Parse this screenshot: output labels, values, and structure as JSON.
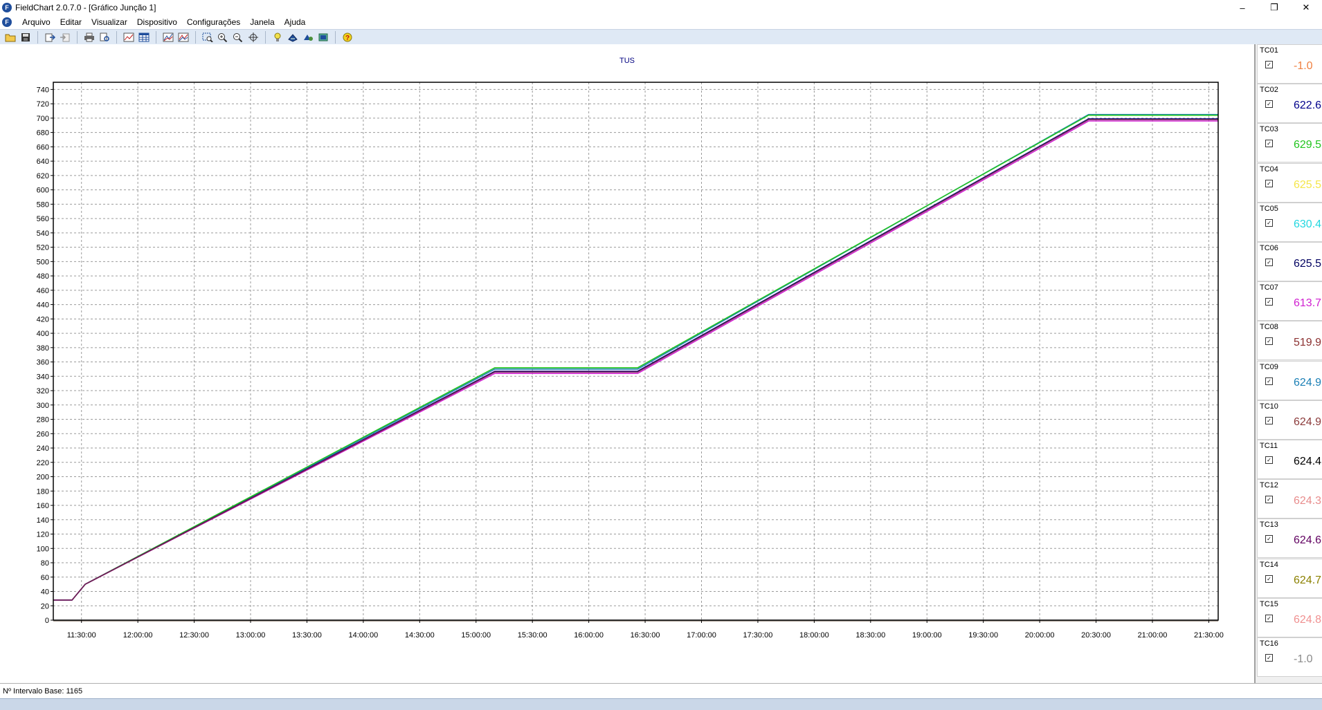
{
  "window": {
    "title": "FieldChart 2.0.7.0 - [Gráfico Junção 1]",
    "logo_letter": "F",
    "min_label": "–",
    "max_label": "❐",
    "close_label": "✕"
  },
  "menu": {
    "items": [
      "Arquivo",
      "Editar",
      "Visualizar",
      "Dispositivo",
      "Configurações",
      "Janela",
      "Ajuda"
    ],
    "mdi_min": "_",
    "mdi_restore": "❐",
    "mdi_close": "×"
  },
  "toolbar": {
    "icons": [
      "open-folder-icon",
      "save-icon",
      "export-icon",
      "import-icon",
      "print-icon",
      "print-preview-icon",
      "chart-view-icon",
      "table-view-icon",
      "chart-add-icon",
      "chart-edit-icon",
      "zoom-rect-icon",
      "zoom-in-icon",
      "zoom-out-icon",
      "crosshair-icon",
      "lightbulb-icon",
      "device-connect-icon",
      "device-config-icon",
      "device-read-icon",
      "help-icon"
    ]
  },
  "chart_data": {
    "type": "line",
    "title": "TUS",
    "xlabel": "",
    "ylabel": "",
    "ylim": [
      0,
      750
    ],
    "yticks": [
      0,
      20,
      40,
      60,
      80,
      100,
      120,
      140,
      160,
      180,
      200,
      220,
      240,
      260,
      280,
      300,
      320,
      340,
      360,
      380,
      400,
      420,
      440,
      460,
      480,
      500,
      520,
      540,
      560,
      580,
      600,
      620,
      640,
      660,
      680,
      700,
      720,
      740
    ],
    "xlim": [
      "11:15:00",
      "21:35:00"
    ],
    "xticks": [
      "11:30:00",
      "12:00:00",
      "12:30:00",
      "13:00:00",
      "13:30:00",
      "14:00:00",
      "14:30:00",
      "15:00:00",
      "15:30:00",
      "16:00:00",
      "16:30:00",
      "17:00:00",
      "17:30:00",
      "18:00:00",
      "18:30:00",
      "19:00:00",
      "19:30:00",
      "20:00:00",
      "20:30:00",
      "21:00:00",
      "21:30:00"
    ],
    "grid": true,
    "series": [
      {
        "color": "#1a7fb5",
        "x": [
          "11:15:00",
          "11:25:00",
          "11:32:00",
          "15:10:00",
          "16:26:00",
          "20:26:00",
          "21:35:00"
        ],
        "y": [
          28,
          28,
          50,
          350,
          350,
          705,
          705
        ]
      },
      {
        "color": "#22c51e",
        "x": [
          "11:15:00",
          "11:25:00",
          "11:32:00",
          "15:10:00",
          "16:26:00",
          "20:26:00",
          "21:35:00"
        ],
        "y": [
          28,
          28,
          50,
          352,
          352,
          704,
          704
        ]
      },
      {
        "color": "#000080",
        "x": [
          "11:15:00",
          "11:25:00",
          "11:32:00",
          "15:10:00",
          "16:26:00",
          "20:26:00",
          "21:35:00"
        ],
        "y": [
          28,
          28,
          50,
          347,
          347,
          699,
          699
        ]
      },
      {
        "color": "#d01fd0",
        "x": [
          "11:15:00",
          "11:25:00",
          "11:32:00",
          "15:10:00",
          "16:26:00",
          "20:26:00",
          "21:35:00"
        ],
        "y": [
          28,
          28,
          50,
          344,
          344,
          696,
          696
        ]
      },
      {
        "color": "#702050",
        "x": [
          "11:15:00",
          "11:25:00",
          "11:32:00",
          "15:10:00",
          "16:26:00",
          "20:26:00",
          "21:35:00"
        ],
        "y": [
          28,
          28,
          50,
          346,
          346,
          698,
          698
        ]
      },
      {
        "color": "#e07820",
        "x": [
          "11:15:00",
          "21:35:00"
        ],
        "y": [
          -1,
          -1
        ]
      },
      {
        "color": "#8a8a8a",
        "x": [
          "11:15:00",
          "21:35:00"
        ],
        "y": [
          -1,
          -1
        ]
      }
    ]
  },
  "channels": [
    {
      "label": "TC01",
      "zero": "0",
      "value": "-1.0",
      "color": "#f08040"
    },
    {
      "label": "TC02",
      "zero": "0",
      "value": "622.6",
      "color": "#00008b"
    },
    {
      "label": "TC03",
      "zero": "0",
      "value": "629.5",
      "color": "#22c51e"
    },
    {
      "label": "TC04",
      "zero": "0",
      "value": "625.5",
      "color": "#f5e64a"
    },
    {
      "label": "TC05",
      "zero": "0",
      "value": "630.4",
      "color": "#22d7e0"
    },
    {
      "label": "TC06",
      "zero": "0",
      "value": "625.5",
      "color": "#000060"
    },
    {
      "label": "TC07",
      "zero": "0",
      "value": "613.7",
      "color": "#d01fd0"
    },
    {
      "label": "TC08",
      "zero": "0",
      "value": "519.9",
      "color": "#8b3030"
    },
    {
      "label": "TC09",
      "zero": "0",
      "value": "624.9",
      "color": "#1a7fb5"
    },
    {
      "label": "TC10",
      "zero": "0",
      "value": "624.9",
      "color": "#8b3a3a"
    },
    {
      "label": "TC11",
      "zero": "0",
      "value": "624.4",
      "color": "#000000"
    },
    {
      "label": "TC12",
      "zero": "0",
      "value": "624.3",
      "color": "#e88c8c"
    },
    {
      "label": "TC13",
      "zero": "0",
      "value": "624.6",
      "color": "#600060"
    },
    {
      "label": "TC14",
      "zero": "0",
      "value": "624.7",
      "color": "#8b8000"
    },
    {
      "label": "TC15",
      "zero": "0",
      "value": "624.8",
      "color": "#f09090"
    },
    {
      "label": "TC16",
      "zero": "0",
      "value": "-1.0",
      "color": "#8a8a8a"
    }
  ],
  "status": {
    "text": "Nº Intervalo Base: 1165"
  }
}
